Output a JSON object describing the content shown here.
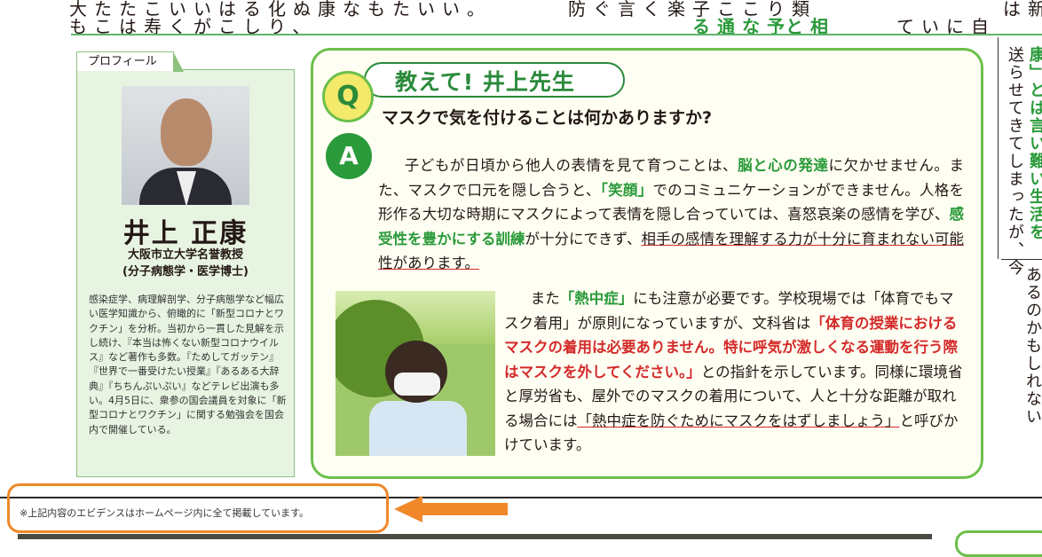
{
  "top_strip": {
    "seg1": "大たたこいいはる化ぬ康なもたいい。",
    "seg2": "もこは寿くがこしり、",
    "seg3": "防ぐ言く楽子ここり類",
    "seg4": "る通な予",
    "seg5": "と相",
    "seg6": "ていに自",
    "seg7": "は新意"
  },
  "profile": {
    "tab_label": "プロフィール",
    "name": "井上 正康",
    "role_line1": "大阪市立大学名誉教授",
    "role_line2": "(分子病態学・医学博士)",
    "bio": "感染症学、病理解剖学、分子病態学など幅広い医学知識から、俯瞰的に「新型コロナとワクチン」を分析。当初から一貫した見解を示し続け、『本当は怖くない新型コロナウイルス』など著作も多数。『ためしてガッテン』『世界で一番受けたい授業』『あるある大辞典』『ちちんぷいぷい』などテレビ出演も多い。4月5日に、衆参の国会議員を対象に「新型コロナとワクチン」に関する勉強会を国会内で開催している。"
  },
  "qa": {
    "q_badge": "Q",
    "a_badge": "A",
    "title": "教えて! 井上先生",
    "question": "マスクで気を付けることは何かありますか?",
    "answer1": {
      "t1": "子どもが日頃から他人の表情を見て育つことは、",
      "g1": "脳と心の発達",
      "t2": "に欠かせません。また、マスクで口元を隠し合うと、",
      "g2": "「笑顔」",
      "t3": "でのコミュニケーションができません。人格を形作る大切な時期にマスクによって表情を隠し合っていては、喜怒哀楽の感情を学び、",
      "g3": "感受性を豊かにする訓練",
      "t4": "が十分にできず、",
      "u1": "相手の感情を理解する力が十分に育まれない可能性があります。"
    },
    "answer2": {
      "t1": "また",
      "g1": "「熱中症」",
      "t2": "にも注意が必要です。学校現場では「体育でもマスク着用」が原則になっていますが、文科省は",
      "r1": "「体育の授業におけるマスクの着用は必要ありません。特に呼気が激しくなる運動を行う際はマスクを外してください。」",
      "t3": "との指針を示しています。同様に環境省と厚労省も、屋外でのマスクの着用について、人と十分な距離が取れる場合には",
      "u1": "「熱中症を防ぐためにマスクをはずしましょう」",
      "t4": "と呼びかけています。"
    }
  },
  "right_column": {
    "line1": "送らせてきてしまったが、今",
    "line2": "康」とは言い難い生活を",
    "line3": "あるのかもしれない"
  },
  "footer": {
    "note": "※上記内容のエビデンスはホームページ内に全て掲載しています。"
  },
  "colors": {
    "green": "#2a9a3a",
    "red": "#d42a2a",
    "orange": "#f0882a",
    "yellow": "#f3e96a"
  }
}
